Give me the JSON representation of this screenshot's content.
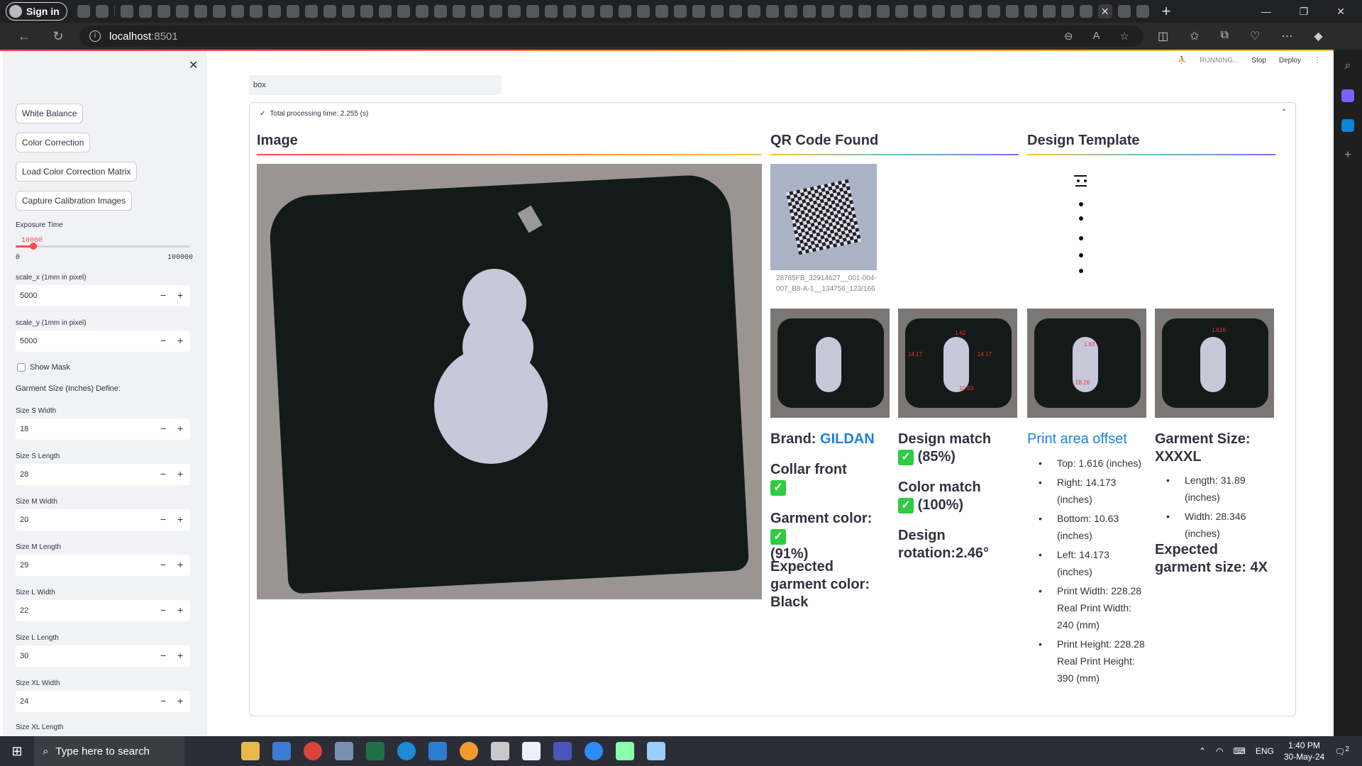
{
  "browser": {
    "signin_label": "Sign in",
    "url_host": "localhost",
    "url_port": ":8501"
  },
  "sidebar": {
    "buttons": [
      "White Balance",
      "Color Correction",
      "Load Color Correction Matrix",
      "Capture Calibration Images"
    ],
    "exposure": {
      "label": "Exposure Time",
      "value": "10000",
      "min": "0",
      "max": "100000",
      "fraction": 0.1
    },
    "scale_x": {
      "label": "scale_x (1mm in pixel)",
      "value": "5000"
    },
    "scale_y": {
      "label": "scale_y (1mm in pixel)",
      "value": "5000"
    },
    "show_mask_label": "Show Mask",
    "garment_define_label": "Garment Size (Inches) Define:",
    "fields": [
      {
        "label": "Size S Width",
        "value": "18"
      },
      {
        "label": "Size S Length",
        "value": "28"
      },
      {
        "label": "Size M Width",
        "value": "20"
      },
      {
        "label": "Size M Length",
        "value": "29"
      },
      {
        "label": "Size L Width",
        "value": "22"
      },
      {
        "label": "Size L Length",
        "value": "30"
      },
      {
        "label": "Size XL Width",
        "value": "24"
      }
    ],
    "last_label": "Size XL Length"
  },
  "status": {
    "running": "RUNNING...",
    "stop": "Stop",
    "deploy": "Deploy"
  },
  "main": {
    "box_value": "box",
    "processing_text": "Total processing time: 2.255 (s)",
    "image_heading": "Image",
    "qr_heading": "QR Code Found",
    "template_heading": "Design Template",
    "qr_caption_1": "28785FB_32914627__001-004-",
    "qr_caption_2": "007_B8-A-1__134756_123/166",
    "thumb_labels": {
      "t2_left": "14.17",
      "t2_right": "14.17",
      "t2_bottom": "10.63",
      "t2_top": "1.62",
      "t3_top": "1.93",
      "t3_bottom": "28.26",
      "t4_top": "1.616"
    },
    "col1": {
      "brand_label": "Brand:",
      "brand_value": "GILDAN",
      "collar": "Collar front",
      "garment_color_label": "Garment color:",
      "garment_color_pct": "(91%)",
      "expected_color": "Expected garment color: Black"
    },
    "col2": {
      "design_match": "Design match",
      "design_match_pct": "(85%)",
      "color_match": "Color match",
      "color_match_pct": "(100%)",
      "rotation": "Design rotation:2.46°"
    },
    "col3": {
      "title": "Print area offset",
      "items": [
        "Top: 1.616 (inches)",
        "Right: 14.173 (inches)",
        "Bottom: 10.63 (inches)",
        "Left: 14.173 (inches)",
        "Print Width: 228.28 Real Print Width: 240 (mm)",
        "Print Height: 228.28 Real Print Height: 390 (mm)"
      ]
    },
    "col4": {
      "title": "Garment Size: XXXXL",
      "items": [
        "Length: 31.89 (inches)",
        "Width: 28.346 (inches)"
      ],
      "expected": "Expected garment size: 4X"
    }
  },
  "taskbar": {
    "search_placeholder": "Type here to search",
    "lang": "ENG",
    "time": "1:40 PM",
    "date": "30-May-24",
    "notif_count": "2"
  },
  "colors": {
    "accent": "#ff4b4b",
    "link": "#1c83e1",
    "check": "#2ecc40"
  }
}
